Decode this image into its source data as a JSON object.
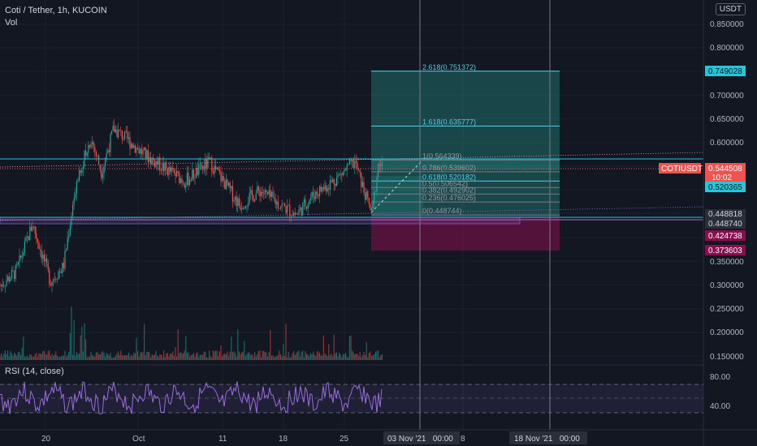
{
  "header": {
    "title": "Coti / Tether, 1h, KUCOIN",
    "vol_label": "Vol"
  },
  "currency_button": "USDT",
  "price_axis": {
    "ticks": [
      "0.850000",
      "0.800000",
      "0.700000",
      "0.650000",
      "0.600000",
      "0.350000",
      "0.300000",
      "0.250000",
      "0.200000",
      "0.150000"
    ],
    "badges": {
      "target": "0.749028",
      "symbol": "COTIUSDT",
      "last": "0.544508",
      "countdown": "10:02",
      "fib618": "0.520365",
      "level_a": "0.448818",
      "level_b": "0.448740",
      "stop": "0.424738",
      "stop_low": "0.373603"
    }
  },
  "fib_levels": [
    {
      "label": "2.618(0.751372)",
      "value": 0.751372
    },
    {
      "label": "1.618(0.635777)",
      "value": 0.635777
    },
    {
      "label": "1(0.564339)",
      "value": 0.564339
    },
    {
      "label": "0.786(0.539602)",
      "value": 0.539602
    },
    {
      "label": "0.618(0.520182)",
      "value": 0.520182
    },
    {
      "label": "0.5(0.506542)",
      "value": 0.506542
    },
    {
      "label": "0.382(0.492902)",
      "value": 0.492902
    },
    {
      "label": "0.236(0.476025)",
      "value": 0.476025
    },
    {
      "label": "0(0.448744)",
      "value": 0.448744
    }
  ],
  "rsi": {
    "label": "RSI (14, close)",
    "ticks": [
      "80.00",
      "40.00"
    ]
  },
  "time_axis": {
    "labels": [
      "20",
      "Oct",
      "11",
      "18",
      "25",
      "8"
    ],
    "highlight_1": "03 Nov '21   00:00",
    "highlight_2": "18 Nov '21   00:00"
  },
  "chart_data": {
    "type": "candlestick",
    "title": "Coti / Tether, 1h, KUCOIN",
    "ylim": [
      0.14,
      0.875
    ],
    "x_labels": [
      "20",
      "Oct",
      "11",
      "18",
      "25",
      "8"
    ],
    "price_path": [
      {
        "x": "start",
        "y": 0.3
      },
      {
        "x": "20",
        "y": 0.43
      },
      {
        "x": "Oct",
        "y": 0.6
      },
      {
        "x": "11",
        "y": 0.54
      },
      {
        "x": "18",
        "y": 0.46
      },
      {
        "x": "25",
        "y": 0.56
      },
      {
        "x": "last",
        "y": 0.5445
      }
    ],
    "last_price": 0.544508,
    "rsi_ylim": [
      20,
      90
    ]
  },
  "colors": {
    "bg": "#131722",
    "up": "#26a69a",
    "down": "#ef5350",
    "cyan": "#26c6da",
    "purple": "#9c6cdf",
    "maroon": "#880e4f"
  }
}
